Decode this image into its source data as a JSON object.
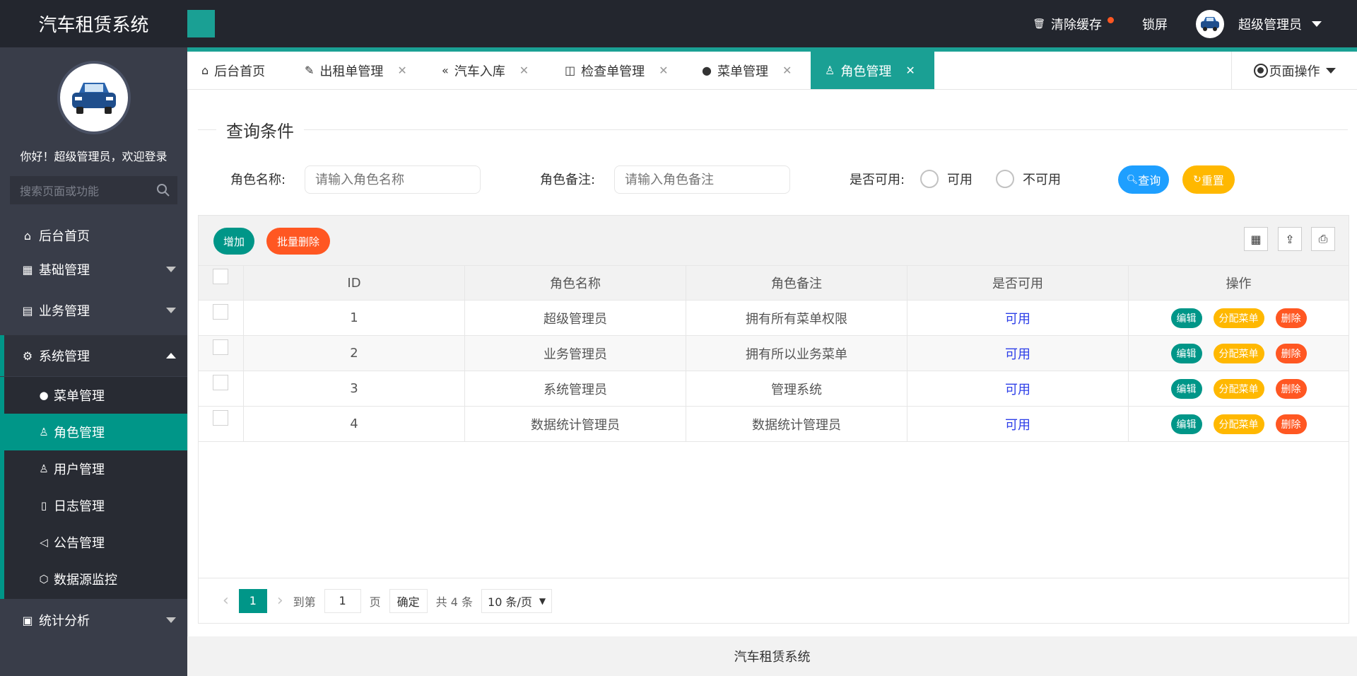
{
  "app": {
    "title": "汽车租赁系统"
  },
  "header": {
    "clear_cache": "清除缓存",
    "lock_screen": "锁屏",
    "user_name": "超级管理员"
  },
  "sidebar": {
    "welcome": "你好！超级管理员，欢迎登录",
    "search_placeholder": "搜索页面或功能",
    "items": [
      {
        "label": "后台首页",
        "icon": "home-icon"
      },
      {
        "label": "基础管理",
        "icon": "grid-icon"
      },
      {
        "label": "业务管理",
        "icon": "building-icon"
      },
      {
        "label": "系统管理",
        "icon": "gear-icon"
      },
      {
        "label": "统计分析",
        "icon": "presentation-icon"
      }
    ],
    "sub_items": [
      {
        "label": "菜单管理",
        "icon": "disc-icon"
      },
      {
        "label": "角色管理",
        "icon": "user-icon"
      },
      {
        "label": "用户管理",
        "icon": "users-icon"
      },
      {
        "label": "日志管理",
        "icon": "note-icon"
      },
      {
        "label": "公告管理",
        "icon": "speaker-icon"
      },
      {
        "label": "数据源监控",
        "icon": "cube-icon"
      }
    ]
  },
  "tabs": [
    {
      "label": "后台首页",
      "icon": "home-icon"
    },
    {
      "label": "出租单管理",
      "icon": "edit-doc-icon"
    },
    {
      "label": "汽车入库",
      "icon": "double-left-icon"
    },
    {
      "label": "检查单管理",
      "icon": "book-icon"
    },
    {
      "label": "菜单管理",
      "icon": "disc-icon"
    },
    {
      "label": "角色管理",
      "icon": "user-icon"
    }
  ],
  "page_ops": "页面操作",
  "query": {
    "legend": "查询条件",
    "name_label": "角色名称:",
    "name_placeholder": "请输入角色名称",
    "remark_label": "角色备注:",
    "remark_placeholder": "请输入角色备注",
    "available_label": "是否可用:",
    "radio_yes": "可用",
    "radio_no": "不可用",
    "search_btn": "查询",
    "reset_btn": "重置"
  },
  "toolbar": {
    "add": "增加",
    "batch_delete": "批量删除"
  },
  "table": {
    "headers": [
      "ID",
      "角色名称",
      "角色备注",
      "是否可用",
      "操作"
    ],
    "rows": [
      {
        "id": "1",
        "name": "超级管理员",
        "remark": "拥有所有菜单权限",
        "available": "可用"
      },
      {
        "id": "2",
        "name": "业务管理员",
        "remark": "拥有所以业务菜单",
        "available": "可用"
      },
      {
        "id": "3",
        "name": "系统管理员",
        "remark": "管理系统",
        "available": "可用"
      },
      {
        "id": "4",
        "name": "数据统计管理员",
        "remark": "数据统计管理员",
        "available": "可用"
      }
    ],
    "actions": {
      "edit": "编辑",
      "assign": "分配菜单",
      "delete": "删除"
    }
  },
  "pager": {
    "current": "1",
    "goto_label": "到第",
    "goto_value": "1",
    "page_unit": "页",
    "confirm": "确定",
    "total": "共 4 条",
    "page_size": "10 条/页"
  },
  "footer": "汽车租赁系统",
  "colors": {
    "teal": "#009688",
    "teal_light": "#1aa094",
    "orange": "#ff5722",
    "yellow": "#ffb800",
    "blue": "#1e9fff",
    "dark": "#23262e"
  }
}
